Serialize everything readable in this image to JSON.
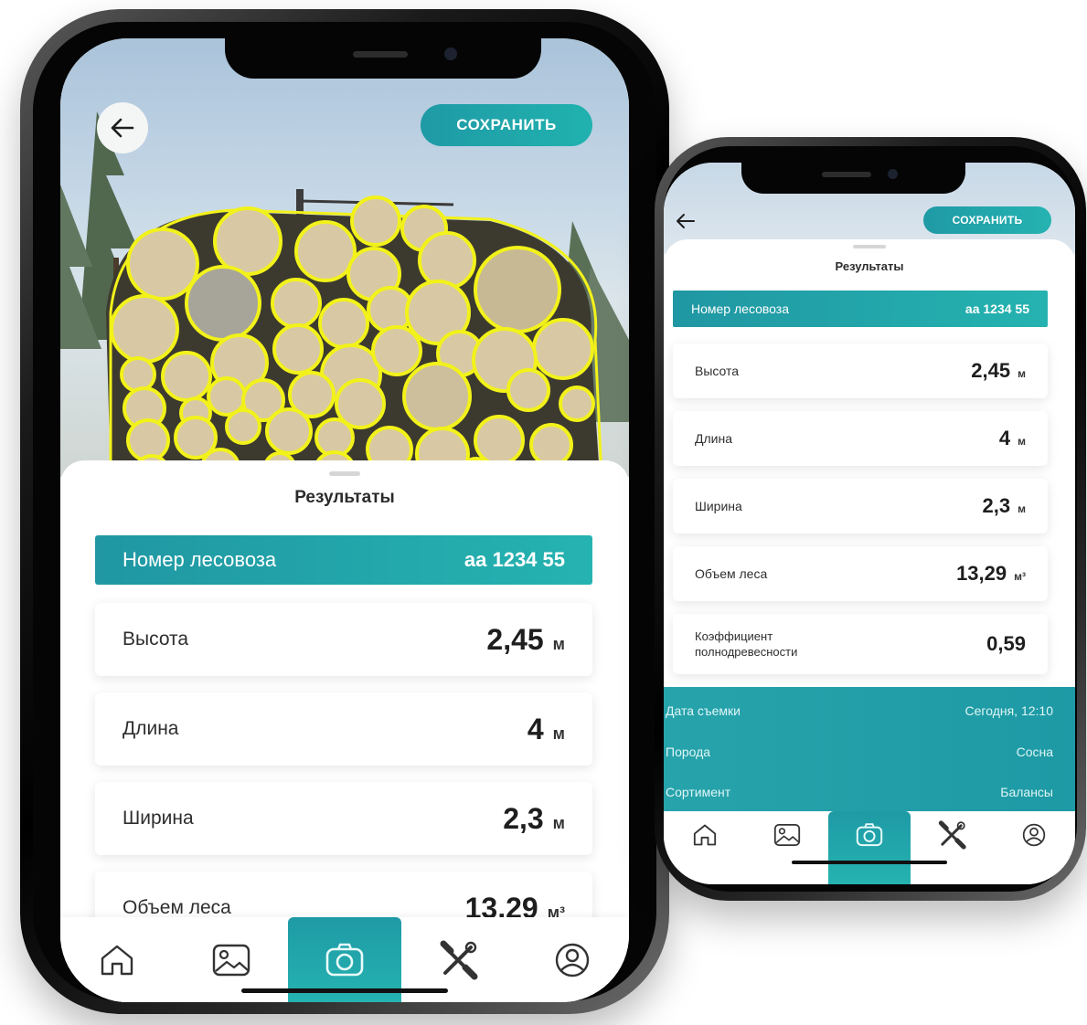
{
  "colors": {
    "accent": "#22A6AC",
    "accent_dark": "#1F97A3",
    "detection_outline": "#F2F21A"
  },
  "phone_large": {
    "save_label": "СОХРАНИТЬ",
    "sheet_title": "Результаты",
    "truck_label": "Номер лесовоза",
    "truck_value": "аа 1234 55",
    "metrics": [
      {
        "label": "Высота",
        "value": "2,45",
        "unit": "м"
      },
      {
        "label": "Длина",
        "value": "4",
        "unit": "м"
      },
      {
        "label": "Ширина",
        "value": "2,3",
        "unit": "м"
      },
      {
        "label": "Объем леса",
        "value": "13,29",
        "unit": "м³"
      }
    ]
  },
  "phone_small": {
    "save_label": "СОХРАНИТЬ",
    "sheet_title": "Результаты",
    "truck_label": "Номер лесовоза",
    "truck_value": "аа 1234 55",
    "metrics": [
      {
        "label": "Высота",
        "value": "2,45",
        "unit": "м"
      },
      {
        "label": "Длина",
        "value": "4",
        "unit": "м"
      },
      {
        "label": "Ширина",
        "value": "2,3",
        "unit": "м"
      },
      {
        "label": "Объем леса",
        "value": "13,29",
        "unit": "м³"
      },
      {
        "label_line1": "Коэффициент",
        "label_line2": "полнодревесности",
        "value": "0,59"
      }
    ],
    "info": [
      {
        "label": "Дата съемки",
        "value": "Сегодня, 12:10"
      },
      {
        "label": "Порода",
        "value": "Сосна"
      },
      {
        "label": "Сортимент",
        "value": "Балансы"
      }
    ]
  },
  "nav_items": [
    {
      "icon": "home-icon"
    },
    {
      "icon": "gallery-icon"
    },
    {
      "icon": "camera-icon",
      "active": true
    },
    {
      "icon": "tools-icon"
    },
    {
      "icon": "profile-icon"
    }
  ]
}
